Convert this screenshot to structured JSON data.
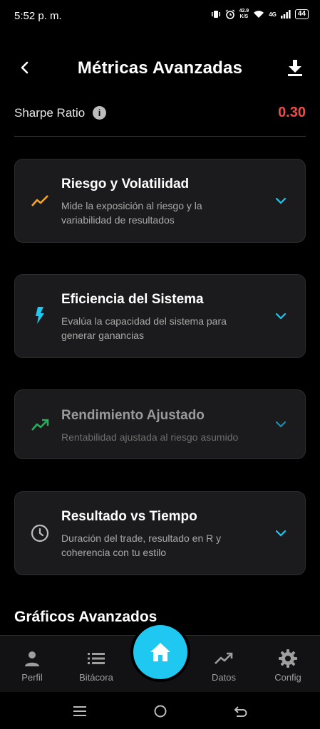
{
  "status_bar": {
    "time": "5:52 p. m.",
    "net_speed_value": "42.9",
    "net_speed_unit": "K/S",
    "network_type": "4G",
    "battery": "44"
  },
  "header": {
    "title": "Métricas Avanzadas"
  },
  "sharpe": {
    "label": "Sharpe Ratio",
    "value": "0.30",
    "info_glyph": "i",
    "value_color": "#f04b4b"
  },
  "cards": [
    {
      "title": "Riesgo y Volatilidad",
      "description": "Mide la exposición al riesgo y la variabilidad de resultados",
      "icon": "trending-line-icon",
      "icon_color": "#f5a623"
    },
    {
      "title": "Eficiencia del Sistema",
      "description": "Evalúa la capacidad del sistema para generar ganancias",
      "icon": "lightning-icon",
      "icon_color": "#1ec8f0"
    },
    {
      "title": "Rendimiento Ajustado",
      "description": "Rentabilidad ajustada al riesgo asumido",
      "icon": "trending-up-icon",
      "icon_color": "#22b05a"
    },
    {
      "title": "Resultado vs Tiempo",
      "description": "Duración del trade, resultado en R y coherencia con tu estilo",
      "icon": "clock-icon",
      "icon_color": "#bdbdbd"
    }
  ],
  "section": {
    "title": "Gráficos Avanzados"
  },
  "bottom_nav": {
    "items": [
      {
        "label": "Perfil",
        "icon": "person-icon"
      },
      {
        "label": "Bitácora",
        "icon": "list-icon"
      },
      {
        "label": "Datos",
        "icon": "chart-icon"
      },
      {
        "label": "Config",
        "icon": "gear-icon"
      }
    ],
    "home_icon": "home-icon",
    "accent": "#1ec8f0"
  }
}
